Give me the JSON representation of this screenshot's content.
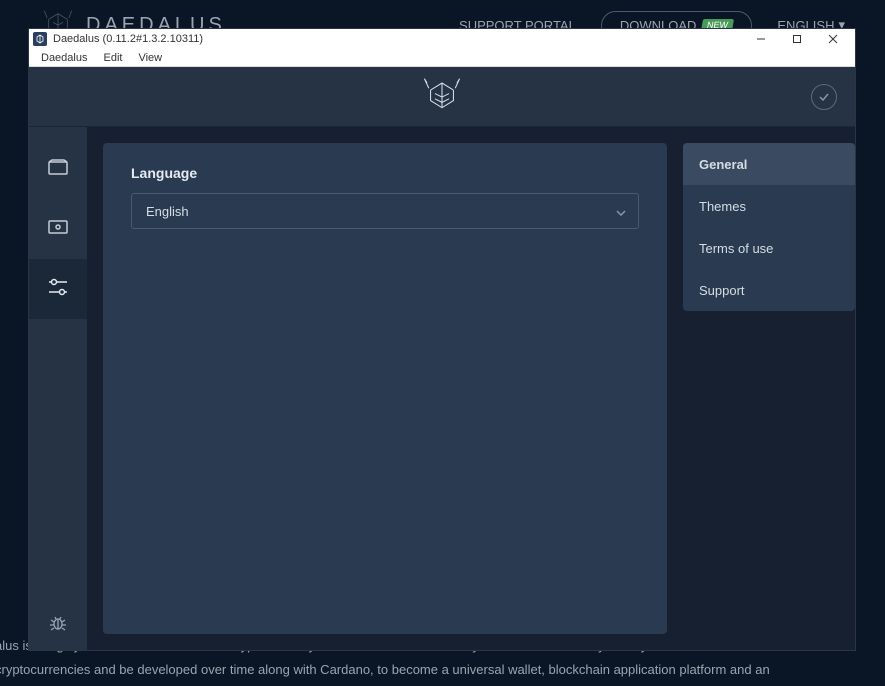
{
  "bg": {
    "logo_text": "DAEDALUS",
    "nav": {
      "support": "SUPPORT PORTAL",
      "download": "DOWNLOAD",
      "new_badge": "NEW",
      "lang": "ENGLISH"
    },
    "footer_line1": "alus is a highly secure wallet for the Ada cryptocurrency. Download and install it so you can use it to safely store your Ada. Daedalus will",
    "footer_line2": "cryptocurrencies and be developed over time along with Cardano, to become a universal wallet, blockchain application platform and an"
  },
  "window": {
    "title": "Daedalus (0.11.2#1.3.2.10311)",
    "menu": {
      "daedalus": "Daedalus",
      "edit": "Edit",
      "view": "View"
    }
  },
  "settings": {
    "language_label": "Language",
    "language_value": "English",
    "nav": {
      "general": "General",
      "themes": "Themes",
      "terms": "Terms of use",
      "support": "Support"
    }
  }
}
